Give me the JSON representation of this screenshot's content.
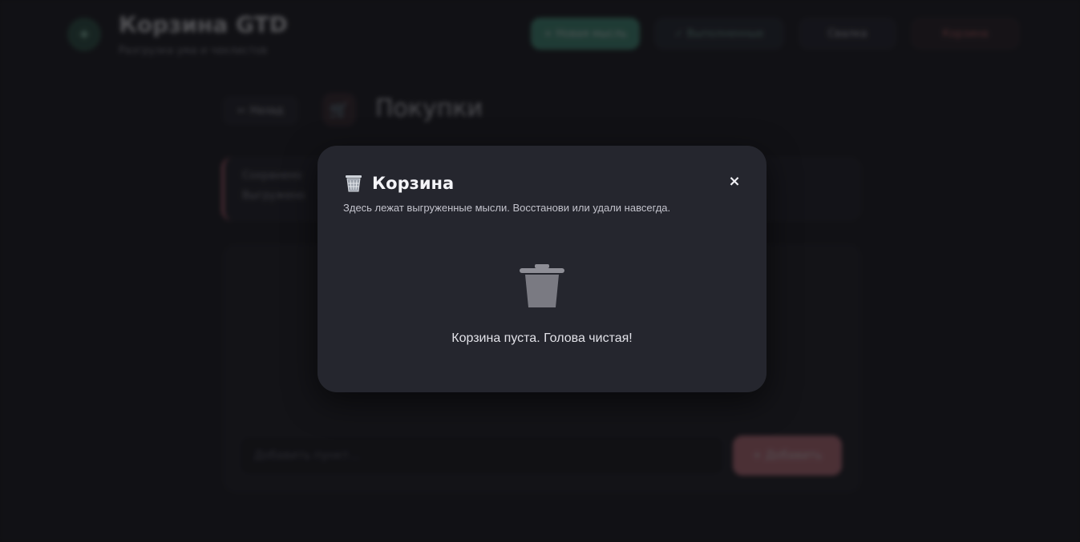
{
  "app": {
    "title": "Корзина GTD",
    "subtitle": "Разгрузка ума и чеклистов",
    "header_buttons": {
      "new": "+ Новая мысль",
      "done": "✓ Выполненные",
      "someday": "Свалка",
      "trash": "Корзина"
    },
    "back_label": "← Назад",
    "category_title": "Покупки",
    "info_lines": [
      "Сохранено",
      "Выгружено"
    ],
    "add_placeholder": "Добавить пункт…",
    "add_button": "+ Добавить"
  },
  "modal": {
    "title": "Корзина",
    "description": "Здесь лежат выгруженные мысли. Восстанови или удали навсегда.",
    "close_label": "×",
    "empty_text": "Корзина пуста. Голова чистая!",
    "title_icon": "wastebasket-icon",
    "empty_icon": "trash-can-icon"
  },
  "colors": {
    "accent_green": "#4aa58a",
    "accent_pink": "#d9808c",
    "modal_bg": "#25262e",
    "danger": "#d46a6a"
  }
}
